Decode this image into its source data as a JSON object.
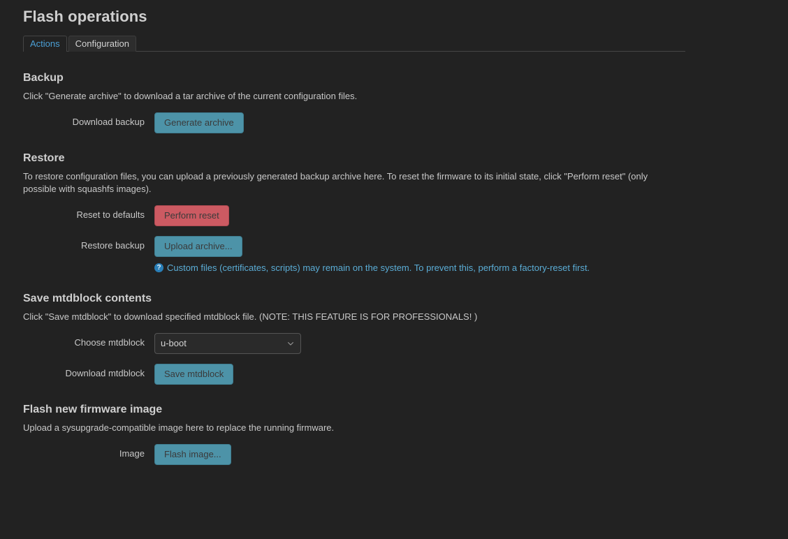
{
  "page": {
    "title": "Flash operations",
    "background_color": "#222222",
    "accent_color": "#4d93a8",
    "danger_color": "#cc5a62",
    "info_color": "#5badd6",
    "active_tab_color": "#4b9fd5"
  },
  "tabs": [
    {
      "label": "Actions",
      "active": true
    },
    {
      "label": "Configuration",
      "active": false
    }
  ],
  "sections": {
    "backup": {
      "heading": "Backup",
      "description": "Click \"Generate archive\" to download a tar archive of the current configuration files.",
      "row_label": "Download backup",
      "button_label": "Generate archive"
    },
    "restore": {
      "heading": "Restore",
      "description": "To restore configuration files, you can upload a previously generated backup archive here. To reset the firmware to its initial state, click \"Perform reset\" (only possible with squashfs images).",
      "reset_label": "Reset to defaults",
      "reset_button_label": "Perform reset",
      "upload_label": "Restore backup",
      "upload_button_label": "Upload archive...",
      "help_icon": "question-circle-icon",
      "help_text": "Custom files (certificates, scripts) may remain on the system. To prevent this, perform a factory-reset first."
    },
    "mtdblock": {
      "heading": "Save mtdblock contents",
      "description": "Click \"Save mtdblock\" to download specified mtdblock file. (NOTE: THIS FEATURE IS FOR PROFESSIONALS! )",
      "choose_label": "Choose mtdblock",
      "selected_option": "u-boot",
      "options": [
        "u-boot"
      ],
      "download_label": "Download mtdblock",
      "download_button_label": "Save mtdblock"
    },
    "firmware": {
      "heading": "Flash new firmware image",
      "description": "Upload a sysupgrade-compatible image here to replace the running firmware.",
      "image_label": "Image",
      "flash_button_label": "Flash image..."
    }
  }
}
